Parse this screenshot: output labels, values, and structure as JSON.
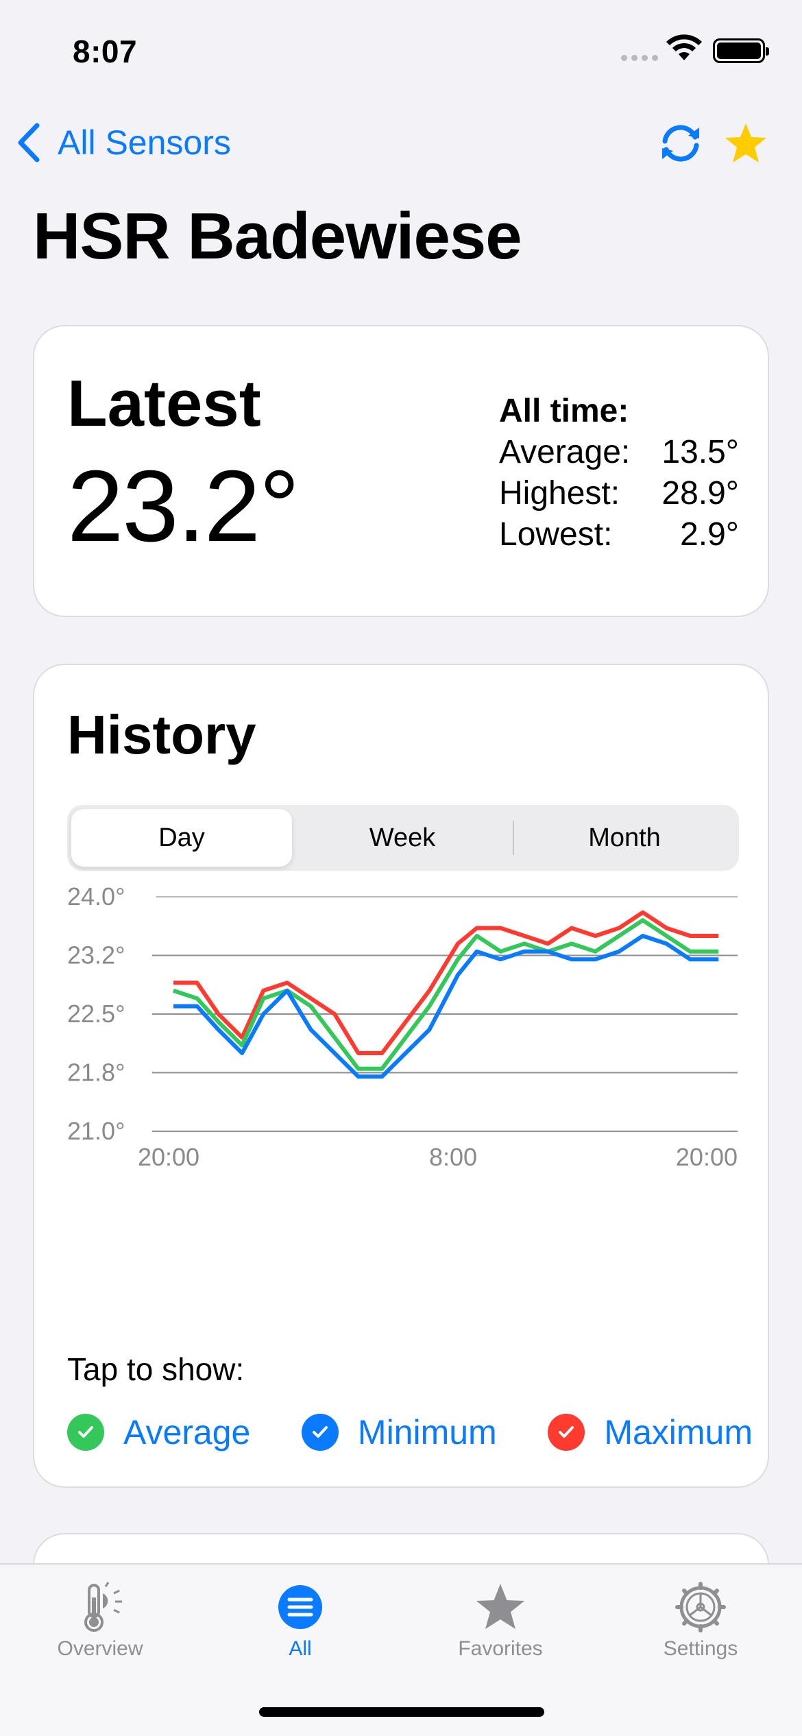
{
  "status_bar": {
    "time": "8:07"
  },
  "nav": {
    "back_label": "All Sensors",
    "title": "HSR Badewiese"
  },
  "latest": {
    "label": "Latest",
    "value": "23.2°",
    "alltime_title": "All time:",
    "stats": [
      {
        "label": "Average:",
        "value": "13.5°"
      },
      {
        "label": "Highest:",
        "value": "28.9°"
      },
      {
        "label": "Lowest:",
        "value": "2.9°"
      }
    ]
  },
  "history": {
    "title": "History",
    "segments": [
      "Day",
      "Week",
      "Month"
    ],
    "selected_segment": "Day",
    "tap_label": "Tap to show:",
    "legend": [
      {
        "label": "Average",
        "color": "#34c759",
        "checked": true
      },
      {
        "label": "Minimum",
        "color": "#0a7aff",
        "checked": true
      },
      {
        "label": "Maximum",
        "color": "#ff3b30",
        "checked": true
      }
    ]
  },
  "chart_data": {
    "type": "line",
    "y_ticks": [
      "24.0°",
      "23.2°",
      "22.5°",
      "21.8°",
      "21.0°"
    ],
    "y_tick_values": [
      24.0,
      23.25,
      22.5,
      21.75,
      21.0
    ],
    "x_ticks": [
      "20:00",
      "8:00",
      "20:00"
    ],
    "x_tick_hours": [
      0,
      12,
      24
    ],
    "ylim": [
      21.0,
      24.0
    ],
    "xlim": [
      0,
      24
    ],
    "grid": true,
    "x_hours": [
      0,
      1,
      2,
      3,
      4,
      5,
      6,
      7,
      8,
      9,
      10,
      11,
      12,
      13,
      14,
      15,
      16,
      17,
      18,
      19,
      20,
      21,
      22,
      23,
      24,
      25
    ],
    "series": [
      {
        "name": "Maximum",
        "color": "#ff3b30",
        "values": [
          22.9,
          22.9,
          22.5,
          22.2,
          22.8,
          22.9,
          22.7,
          22.5,
          22.0,
          22.0,
          22.4,
          22.8,
          23.4,
          23.6,
          23.6,
          23.5,
          23.4,
          23.6,
          23.5,
          23.6,
          23.8,
          23.6,
          23.5,
          23.5
        ]
      },
      {
        "name": "Average",
        "color": "#34c759",
        "values": [
          22.8,
          22.7,
          22.4,
          22.1,
          22.7,
          22.8,
          22.6,
          22.2,
          21.8,
          21.8,
          22.2,
          22.6,
          23.2,
          23.5,
          23.3,
          23.4,
          23.3,
          23.4,
          23.3,
          23.5,
          23.7,
          23.5,
          23.3,
          23.3
        ]
      },
      {
        "name": "Minimum",
        "color": "#0a7aff",
        "values": [
          22.6,
          22.6,
          22.3,
          22.0,
          22.5,
          22.8,
          22.3,
          22.0,
          21.7,
          21.7,
          22.0,
          22.3,
          23.0,
          23.3,
          23.2,
          23.3,
          23.3,
          23.2,
          23.2,
          23.3,
          23.5,
          23.4,
          23.2,
          23.2
        ]
      }
    ],
    "x_values_note_hours": [
      0.2,
      1.2,
      2.1,
      3.1,
      4.0,
      5.0,
      6.0,
      7.0,
      8.0,
      9.0,
      10.0,
      11.0,
      12.2,
      13.0,
      14.0,
      15.0,
      16.0,
      17.0,
      18.0,
      19.0,
      20.0,
      21.0,
      22.0,
      23.2
    ]
  },
  "tab_bar": {
    "tabs": [
      {
        "label": "Overview",
        "icon": "thermometer-sun-icon",
        "active": false
      },
      {
        "label": "All",
        "icon": "list-icon",
        "active": true
      },
      {
        "label": "Favorites",
        "icon": "star-icon",
        "active": false
      },
      {
        "label": "Settings",
        "icon": "gear-icon",
        "active": false
      }
    ]
  }
}
